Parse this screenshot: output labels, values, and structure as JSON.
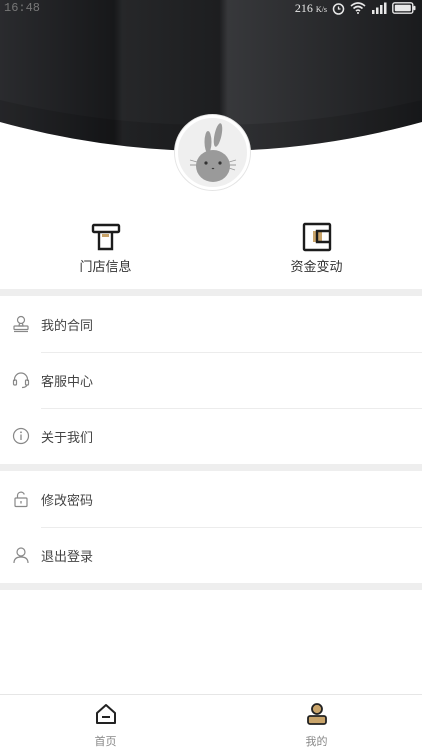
{
  "status_bar": {
    "time": "16:48",
    "speed_value": "216",
    "speed_unit": "K/s"
  },
  "profile": {
    "avatar_icon": "rabbit-avatar-icon"
  },
  "quick_actions": [
    {
      "label": "门店信息",
      "icon": "store-icon"
    },
    {
      "label": "资金变动",
      "icon": "wallet-icon"
    }
  ],
  "menu_group_1": [
    {
      "label": "我的合同",
      "icon": "stamp-icon"
    },
    {
      "label": "客服中心",
      "icon": "headset-icon"
    },
    {
      "label": "关于我们",
      "icon": "info-icon"
    }
  ],
  "menu_group_2": [
    {
      "label": "修改密码",
      "icon": "lock-icon"
    },
    {
      "label": "退出登录",
      "icon": "user-icon"
    }
  ],
  "tabbar": {
    "tabs": [
      {
        "label": "首页",
        "icon": "home-icon"
      },
      {
        "label": "我的",
        "icon": "profile-icon"
      }
    ],
    "active": "我的"
  },
  "colors": {
    "accent": "#c9a46a",
    "header_dark": "#1c1d1f",
    "divider": "#eeeeee"
  }
}
